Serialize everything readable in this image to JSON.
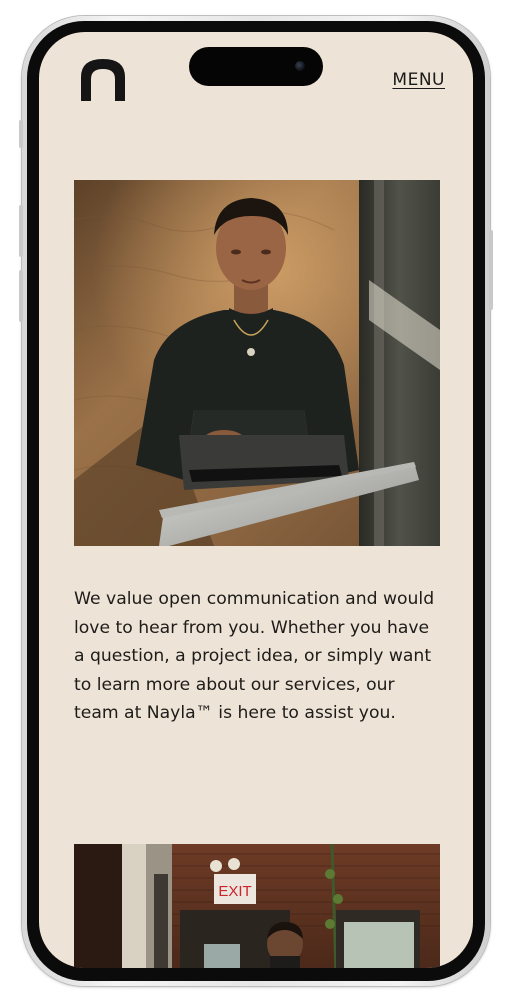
{
  "header": {
    "logo_icon": "arch-logo-icon",
    "menu_label": "MENU"
  },
  "main": {
    "hero_image": {
      "subject": "man-with-laptop-photo"
    },
    "intro_text": "We value open communication and would love to hear from you. Whether you have a question, a project idea, or simply want to learn more about our services, our team at Nayla™ is here to assist you.",
    "second_image": {
      "subject": "office-photo",
      "sign_text": "EXIT"
    }
  },
  "colors": {
    "background": "#ede3d6",
    "text": "#1e1c1a",
    "frame": "#0b0b0b"
  }
}
